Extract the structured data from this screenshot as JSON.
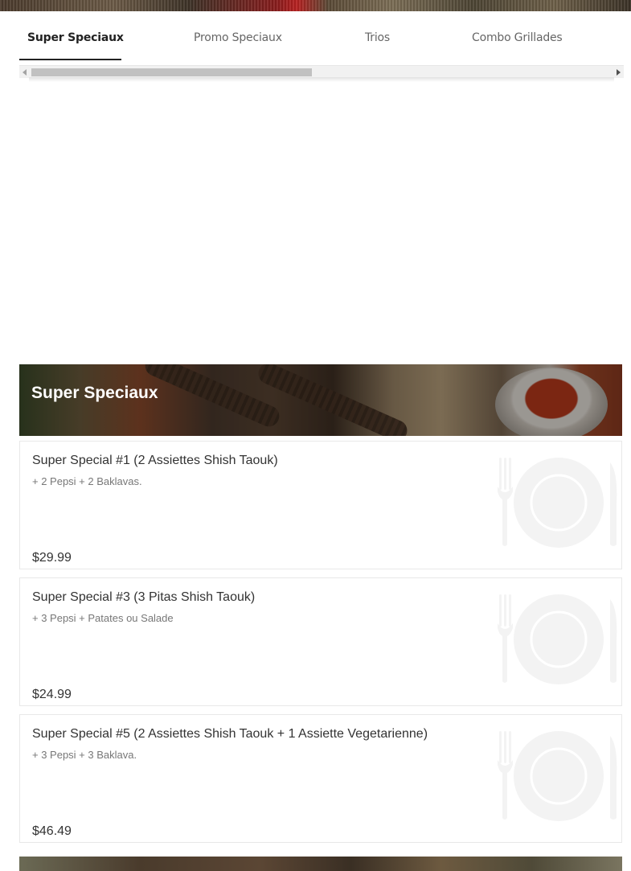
{
  "tabs": [
    {
      "label": "Super Speciaux",
      "active": true
    },
    {
      "label": "Promo Speciaux",
      "active": false
    },
    {
      "label": "Trios",
      "active": false
    },
    {
      "label": "Combo Grillades",
      "active": false
    }
  ],
  "section": {
    "title": "Super Speciaux"
  },
  "items": [
    {
      "name": "Super Special #1 (2 Assiettes Shish Taouk)",
      "description": "+ 2 Pepsi + 2 Baklavas.",
      "price": "$29.99"
    },
    {
      "name": "Super Special #3 (3 Pitas Shish Taouk)",
      "description": "+ 3 Pepsi + Patates ou Salade",
      "price": "$24.99"
    },
    {
      "name": "Super Special #5 (2 Assiettes Shish Taouk + 1 Assiette Vegetarienne)",
      "description": "+ 3 Pepsi + 3 Baklava.",
      "price": "$46.49"
    }
  ],
  "icons": {
    "scroll_left": "triangle-left-icon",
    "scroll_right": "triangle-right-icon",
    "item_placeholder": "plate-fork-knife-icon"
  },
  "colors": {
    "active_tab_text": "#222222",
    "inactive_tab_text": "#666666",
    "section_title": "#ffffff",
    "price_text": "#333333"
  }
}
